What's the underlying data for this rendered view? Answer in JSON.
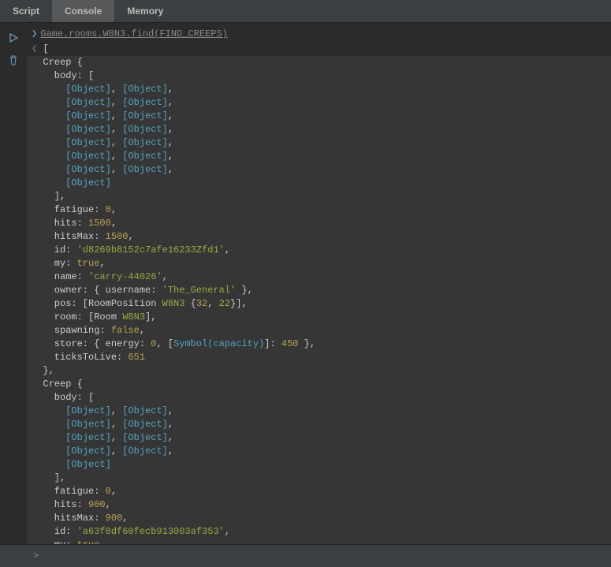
{
  "tabs": [
    {
      "label": "Script",
      "active": false
    },
    {
      "label": "Console",
      "active": true
    },
    {
      "label": "Memory",
      "active": false
    }
  ],
  "command": "Game.rooms.W8N3.find(FIND_CREEPS)",
  "obj_label": "[Object]",
  "creeps": [
    {
      "bodyPairs": 7,
      "bodyTail": true,
      "fatigue": 0,
      "hits": 1500,
      "hitsMax": 1500,
      "id": "'d8269b8152c7afe16233Zfd1'",
      "my": "true",
      "name": "'carry-44026'",
      "ownerUsername": "'The_General'",
      "roomName": "W8N3",
      "posX": 32,
      "posY": 22,
      "spawning": "false",
      "storeEnergy": 0,
      "storeCapacity": 450,
      "capacitySym": "Symbol(capacity)",
      "ticksToLive": 651
    },
    {
      "bodyPairs": 4,
      "bodyTail": true,
      "fatigue": 0,
      "hits": 900,
      "hitsMax": 900,
      "id": "'a63f0df60fecb913003af353'",
      "my": "true"
    }
  ],
  "l": {
    "openArr": "[",
    "creepOpen": "Creep {",
    "bodyOpen": "body: [",
    "closeArr": "],",
    "fatigue": "fatigue: ",
    "hits": "hits: ",
    "hitsMax": "hitsMax: ",
    "id": "id: ",
    "my": "my: ",
    "name": "name: ",
    "owner": "owner: { username: ",
    "ownerClose": " },",
    "pos": "pos: [RoomPosition ",
    "posMid": " {",
    "posEnd": "}],",
    "room": "room: [Room ",
    "roomEnd": "],",
    "spawning": "spawning: ",
    "store": "store: { energy: ",
    "storeMid": ", [",
    "storeMid2": "]: ",
    "storeEnd": " },",
    "ttl": "ticksToLive: ",
    "closeObj": "},"
  },
  "footer_prompt": ">"
}
